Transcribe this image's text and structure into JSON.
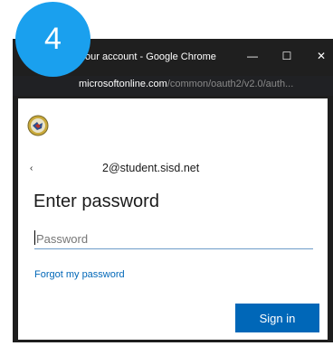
{
  "badge": {
    "number": "4"
  },
  "window": {
    "title": "our account - Google Chrome",
    "controls": {
      "minimize": "—",
      "maximize": "☐",
      "close": "✕"
    }
  },
  "address": {
    "host": "microsoftonline.com",
    "path": "/common/oauth2/v2.0/auth..."
  },
  "signin": {
    "back_icon": "‹",
    "identity": "2@student.sisd.net",
    "heading": "Enter password",
    "password_placeholder": "Password",
    "password_value": "",
    "forgot_link": "Forgot my password",
    "submit_label": "Sign in"
  },
  "colors": {
    "accent": "#0067b8",
    "badge": "#1aa0ee",
    "chrome_dark": "#1f1f1f"
  }
}
